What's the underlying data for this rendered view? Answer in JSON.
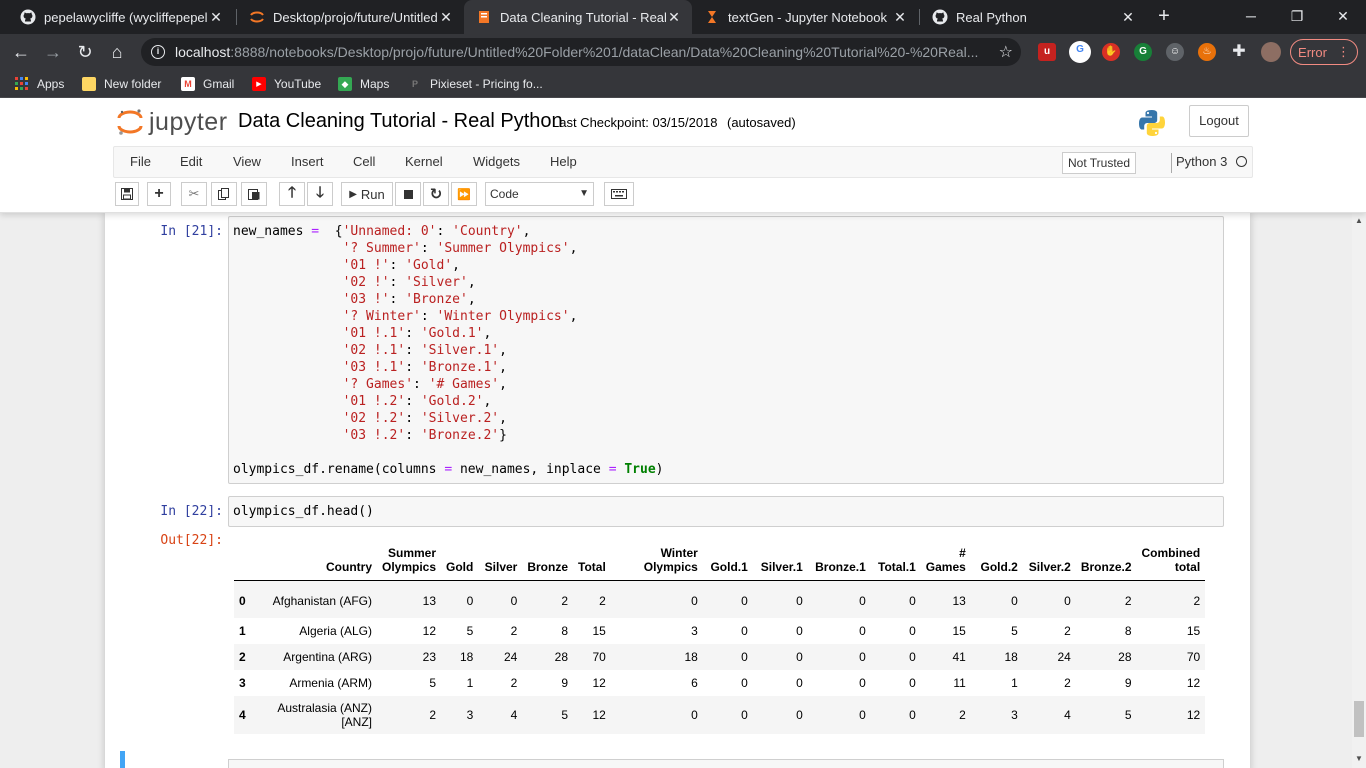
{
  "browser": {
    "tabs": [
      {
        "title": "pepelawycliffe (wycliffepepela)",
        "icon": "github-icon",
        "active": false
      },
      {
        "title": "Desktop/projo/future/Untitled",
        "icon": "jupyter-icon",
        "active": false
      },
      {
        "title": "Data Cleaning Tutorial - Real P",
        "icon": "notebook-icon",
        "active": true
      },
      {
        "title": "textGen - Jupyter Notebook",
        "icon": "hourglass-icon",
        "active": false
      },
      {
        "title": "Real Python",
        "icon": "github-icon",
        "active": false
      }
    ],
    "url_host": "localhost",
    "url_rest": ":8888/notebooks/Desktop/projo/future/Untitled%20Folder%201/dataClean/Data%20Cleaning%20Tutorial%20-%20Real...",
    "error_label": "Error",
    "bookmarks": [
      {
        "label": "Apps",
        "icon": "apps-grid-icon"
      },
      {
        "label": "New folder",
        "icon": "folder-icon"
      },
      {
        "label": "Gmail",
        "icon": "gmail-icon"
      },
      {
        "label": "YouTube",
        "icon": "youtube-icon"
      },
      {
        "label": "Maps",
        "icon": "maps-icon"
      },
      {
        "label": "Pixieset - Pricing fo...",
        "icon": "pixieset-icon"
      }
    ],
    "accent_colors": {
      "error": "#f28b82",
      "tab_bg": "#202124",
      "active_tab": "#35363a"
    }
  },
  "jupyter": {
    "logo_text": "jupyter",
    "notebook_title": "Data Cleaning Tutorial - Real Python",
    "checkpoint": "Last Checkpoint: 03/15/2018",
    "autosaved": "(autosaved)",
    "logout": "Logout",
    "menu": [
      "File",
      "Edit",
      "View",
      "Insert",
      "Cell",
      "Kernel",
      "Widgets",
      "Help"
    ],
    "trust": "Not Trusted",
    "kernel": "Python 3",
    "toolbar": {
      "run_label": "Run",
      "cell_type": "Code"
    }
  },
  "cells": {
    "in21_prompt": "In [21]:",
    "in22_prompt": "In [22]:",
    "out22_prompt": "Out[22]:",
    "in22_code": "olympics_df.head()"
  },
  "dataframe": {
    "columns": [
      "",
      "Country",
      "Summer Olympics",
      "Gold",
      "Silver",
      "Bronze",
      "Total",
      "Winter Olympics",
      "Gold.1",
      "Silver.1",
      "Bronze.1",
      "Total.1",
      "# Games",
      "Gold.2",
      "Silver.2",
      "Bronze.2",
      "Combined total"
    ],
    "rows": [
      {
        "index": "0",
        "country": "Afghanistan (AFG)",
        "values": [
          "13",
          "0",
          "0",
          "2",
          "2",
          "0",
          "0",
          "0",
          "0",
          "0",
          "13",
          "0",
          "0",
          "2",
          "2"
        ]
      },
      {
        "index": "1",
        "country": "Algeria (ALG)",
        "values": [
          "12",
          "5",
          "2",
          "8",
          "15",
          "3",
          "0",
          "0",
          "0",
          "0",
          "15",
          "5",
          "2",
          "8",
          "15"
        ]
      },
      {
        "index": "2",
        "country": "Argentina (ARG)",
        "values": [
          "23",
          "18",
          "24",
          "28",
          "70",
          "18",
          "0",
          "0",
          "0",
          "0",
          "41",
          "18",
          "24",
          "28",
          "70"
        ]
      },
      {
        "index": "3",
        "country": "Armenia (ARM)",
        "values": [
          "5",
          "1",
          "2",
          "9",
          "12",
          "6",
          "0",
          "0",
          "0",
          "0",
          "11",
          "1",
          "2",
          "9",
          "12"
        ]
      },
      {
        "index": "4",
        "country": "Australasia (ANZ) [ANZ]",
        "values": [
          "2",
          "3",
          "4",
          "5",
          "12",
          "0",
          "0",
          "0",
          "0",
          "0",
          "2",
          "3",
          "4",
          "5",
          "12"
        ]
      }
    ]
  }
}
